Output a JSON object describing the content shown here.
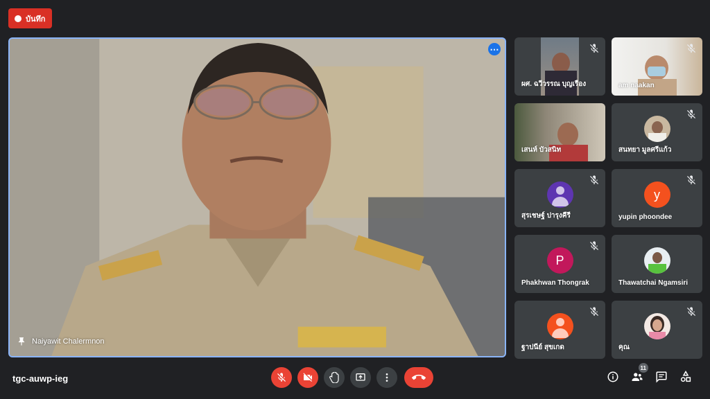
{
  "recording": {
    "label": "บันทึก",
    "color": "#d93025"
  },
  "main": {
    "participant_name": "Naiyawit Chalermnon",
    "more_icon": "more-options-icon",
    "pin_icon": "pin-icon"
  },
  "tiles": [
    {
      "name": "ผศ. ฉวีวรรณ บุญเรือง",
      "type": "video",
      "muted": true
    },
    {
      "name": "am naakan",
      "type": "video",
      "muted": true
    },
    {
      "name": "เสนห์ บัวสนิท",
      "type": "video",
      "muted": false
    },
    {
      "name": "สนทยา มูลศรีแก้ว",
      "type": "photo",
      "muted": true
    },
    {
      "name": "สุรเชษฐ์ ปารุงคีรี",
      "type": "avatar",
      "muted": true,
      "avatar_color": "#5e35b1"
    },
    {
      "name": "yupin phoondee",
      "type": "letter",
      "muted": true,
      "letter": "y",
      "avatar_color": "#f4511e"
    },
    {
      "name": "Phakhwan Thongrak",
      "type": "letter",
      "muted": true,
      "letter": "P",
      "avatar_color": "#c2185b"
    },
    {
      "name": "Thawatchai Ngamsiri",
      "type": "photo",
      "muted": false
    },
    {
      "name": "ฐาปนีย์ สุขเกด",
      "type": "avatar",
      "muted": true,
      "avatar_color": "#f4511e"
    },
    {
      "name": "คุณ",
      "type": "photo",
      "muted": true
    }
  ],
  "bottom": {
    "meeting_code": "tgc-auwp-ieg",
    "people_count": "11",
    "controls": [
      "mic-off-icon",
      "camera-off-icon",
      "raise-hand-icon",
      "present-icon",
      "more-options-icon",
      "end-call-icon"
    ],
    "right_icons": [
      "info-icon",
      "people-icon",
      "chat-icon",
      "activities-icon"
    ]
  }
}
